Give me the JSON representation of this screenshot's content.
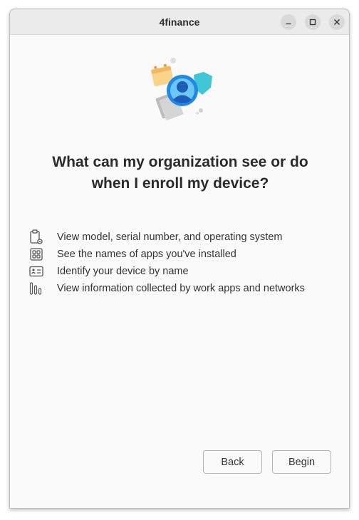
{
  "window": {
    "title": "4finance",
    "controls": {
      "minimize": "minimize-icon",
      "maximize": "maximize-icon",
      "close": "close-icon"
    }
  },
  "hero": {
    "illustration": "privacy-person-illustration"
  },
  "heading": {
    "line1": "What can my organization see or do",
    "line2": "when I enroll my device?"
  },
  "features": [
    {
      "icon": "clipboard-gear-icon",
      "label": "View model, serial number, and operating system"
    },
    {
      "icon": "apps-grid-icon",
      "label": "See the names of apps you've installed"
    },
    {
      "icon": "id-card-icon",
      "label": "Identify your device by name"
    },
    {
      "icon": "bar-chart-icon",
      "label": "View information collected by work apps and networks"
    }
  ],
  "footer": {
    "back_label": "Back",
    "begin_label": "Begin"
  },
  "colors": {
    "accent": "#1e88e5",
    "accent_light": "#4fc3f7",
    "text": "#2b2b2b"
  }
}
